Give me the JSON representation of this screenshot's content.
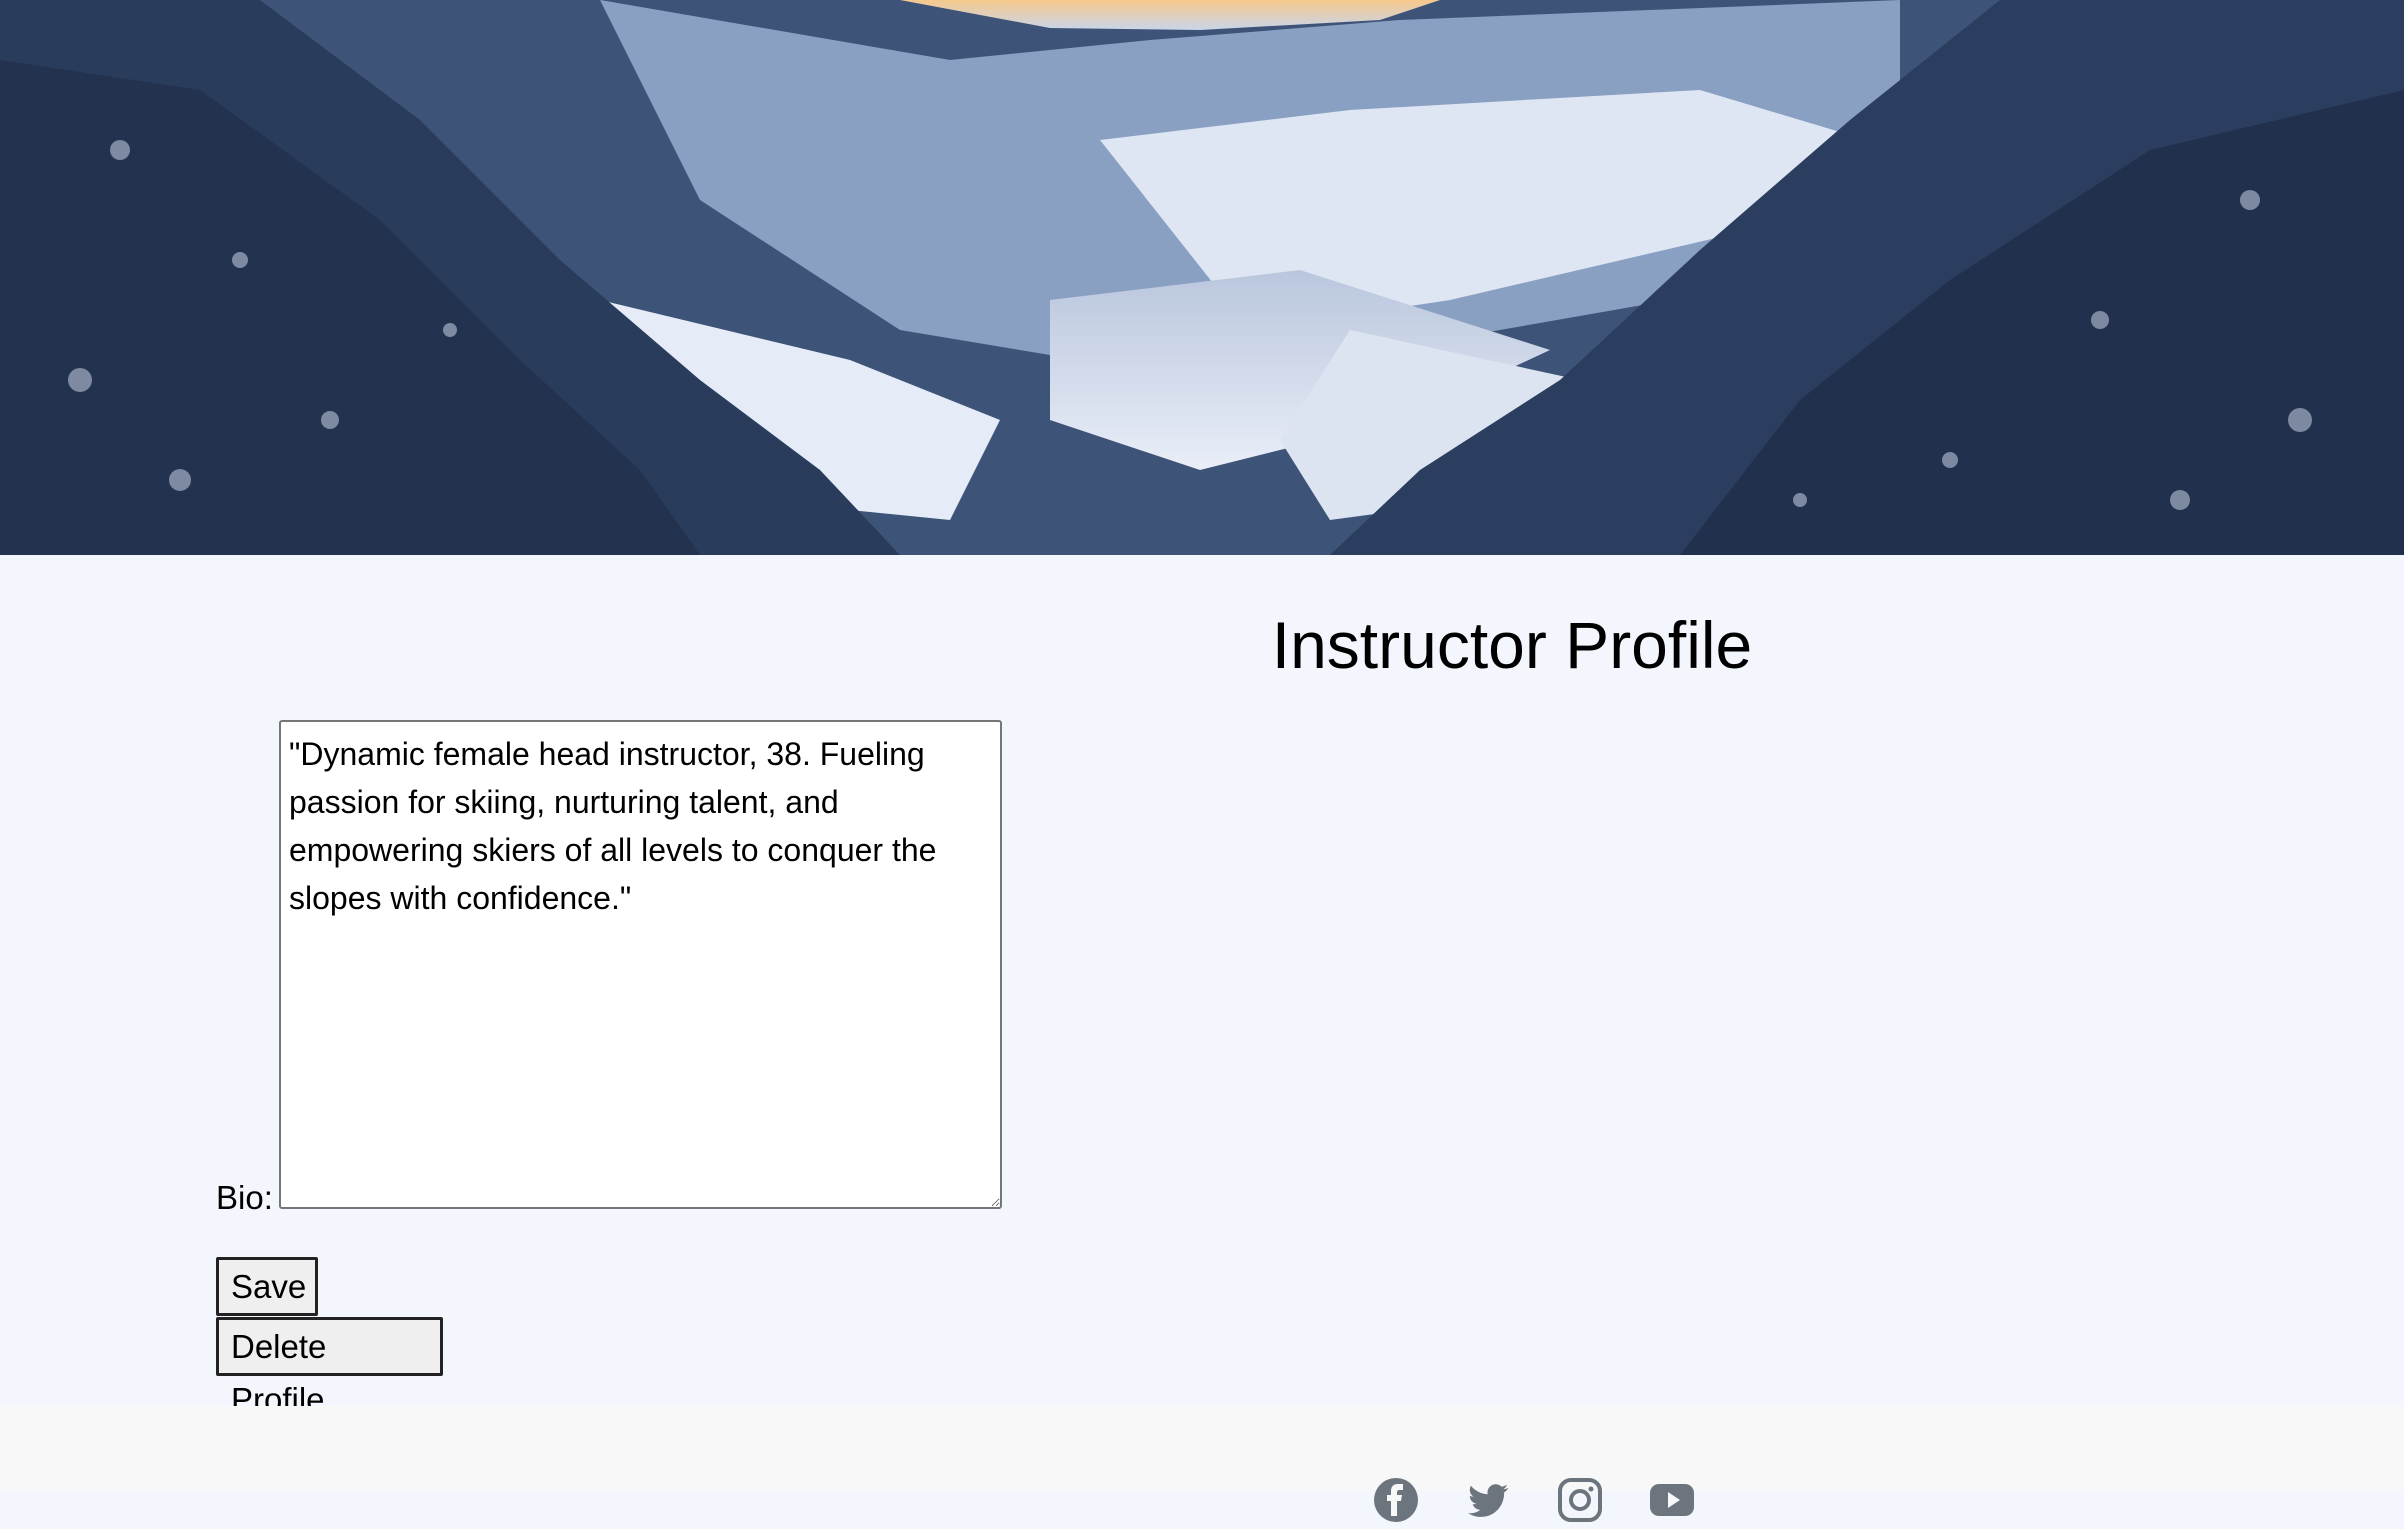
{
  "page": {
    "title": "Instructor Profile"
  },
  "hero": {
    "image": "snowy-mountain-valley-sunrise"
  },
  "form": {
    "bio_label": "Bio:",
    "bio_value": "\"Dynamic female head instructor, 38. Fueling passion for skiing, nurturing talent, and empowering skiers of all levels to conquer the slopes with confidence.\"",
    "save_label": "Save",
    "delete_label": "Delete Profile"
  },
  "footer": {
    "social_icons": [
      "facebook-icon",
      "twitter-icon",
      "instagram-icon",
      "youtube-icon"
    ]
  },
  "colors": {
    "page_bg": "#f3f6fd",
    "footer_bg": "#f8f8f9",
    "icon_gray": "#6c757d"
  }
}
